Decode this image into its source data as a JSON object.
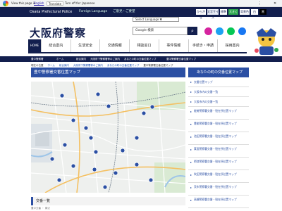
{
  "translate_bar": {
    "view_text": "View this page in:",
    "language": "English",
    "translate_label": "Translate",
    "turn_off": "Turn off for: Japanese",
    "options": "⋮",
    "close": "✕"
  },
  "top_nav": {
    "police_name": "Osaka Prefectural Police",
    "foreign_language": "Foreign Language",
    "guide_link": "ご意見・ご要望",
    "chips": [
      {
        "label": "ひらがな",
        "bg": "#ffffff",
        "fg": "#131f4e"
      },
      {
        "label": "文字サイズ",
        "bg": "#e9edf5",
        "fg": "#131f4e"
      },
      {
        "label": "標準",
        "bg": "#ffffff",
        "fg": "#131f4e"
      },
      {
        "label": "大きく",
        "bg": "#2fa84f",
        "fg": "#ffffff"
      },
      {
        "label": "背景色",
        "bg": "#ffffff",
        "fg": "#131f4e"
      },
      {
        "label": "白",
        "bg": "#ffffff",
        "fg": "#131f4e"
      },
      {
        "label": "黒",
        "bg": "#000000",
        "fg": "#ffffff"
      }
    ]
  },
  "select_language": {
    "label": "Select Language ▼"
  },
  "header": {
    "logo": "大阪府警察",
    "search_value": "Google 検索",
    "search_icon": "magnifier-icon",
    "social": [
      {
        "name": "instagram-icon",
        "color": "#d6249f"
      },
      {
        "name": "twitter-icon",
        "color": "#1da1f2"
      },
      {
        "name": "line-icon",
        "color": "#06c755"
      },
      {
        "name": "facebook-icon",
        "color": "#1877f2"
      }
    ]
  },
  "menu": {
    "home": "HOME",
    "items": [
      "総合案内",
      "生活安全",
      "交通情報",
      "相談窓口",
      "事件情報",
      "手続き・申請",
      "採用案内"
    ]
  },
  "breadcrumb_bar": {
    "items": [
      "豊中警察署",
      "ホーム",
      "総合案内",
      "大阪府下警察署等のご案内",
      "あなたの町の交番位置マップ",
      "豊中警察署交番位置マップ"
    ]
  },
  "crumbs": [
    "現在の位置",
    "ホーム",
    "総合案内",
    "大阪府下警察署等のご案内",
    "あなたの町の交番位置マップ",
    "豊中警察署交番位置マップ"
  ],
  "page_title": "豊中警察署交番位置マップ",
  "map": {
    "pins": 20
  },
  "section_heading": "交番一覧",
  "next_item": "豊中交番 ・ 周辺",
  "side": {
    "heading": "あなたの町の交番位置マップ",
    "links": [
      "交番位置マップ",
      "大阪市内の交番一覧",
      "大阪市内の交番一覧",
      "能勢警察署交番・駐在所位置マップ",
      "豊能警察署交番・駐在所位置マップ",
      "池田警察署交番・駐在所位置マップ",
      "箕面警察署交番・駐在所位置マップ",
      "摂津警察署交番・駐在所位置マップ",
      "吹田警察署交番・駐在所位置マップ",
      "茨木警察署交番・駐在所位置マップ",
      "高槻警察署交番・駐在所位置マップ"
    ]
  }
}
